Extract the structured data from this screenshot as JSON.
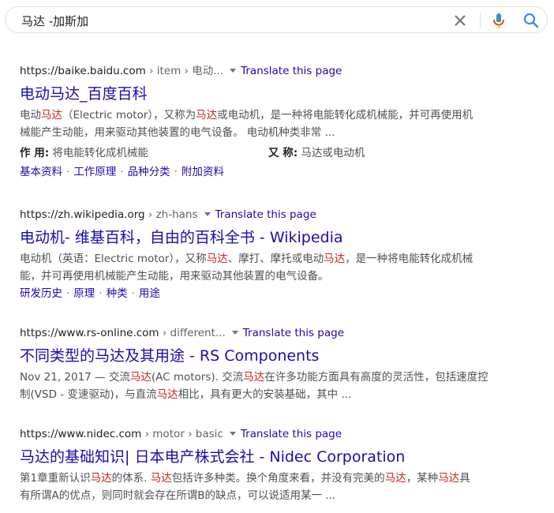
{
  "search": {
    "query": "马达 -加斯加"
  },
  "translate_label": "Translate this page",
  "results": [
    {
      "cite_domain": "https://baike.baidu.com",
      "cite_path": " › item › 电动...",
      "title": "电动马达_百度百科",
      "snippet": [
        "电动",
        {
          "hl": "马达"
        },
        "（Electric motor），又称为",
        {
          "hl": "马达"
        },
        "或电动机，是一种将电能转化成机械能，并可再使用机",
        {
          "br": true
        },
        "械能产生动能，用来驱动其他装置的电气设备。 电动机种类非常 ..."
      ],
      "meta": [
        {
          "label": "作 用:",
          "value": "将电能转化成机械能"
        },
        {
          "label": "又 称:",
          "value": "马达或电动机"
        }
      ],
      "sitelinks": [
        "基本资料",
        "工作原理",
        "品种分类",
        "附加资料"
      ]
    },
    {
      "cite_domain": "https://zh.wikipedia.org",
      "cite_path": " › zh-hans",
      "title": "电动机- 维基百科，自由的百科全书 - Wikipedia",
      "snippet": [
        "电动机（英语：Electric motor），又称",
        {
          "hl": "马达"
        },
        "、摩打、摩托或电动",
        {
          "hl": "马达"
        },
        "，是一种将电能转化成机械",
        {
          "br": true
        },
        "能，并可再使用机械能产生动能，用来驱动其他装置的电气设备。"
      ],
      "sitelinks": [
        "研发历史",
        "原理",
        "种类",
        "用途"
      ]
    },
    {
      "cite_domain": "https://www.rs-online.com",
      "cite_path": " › different...",
      "title": "不同类型的马达及其用途 - RS Components",
      "snippet": [
        "Nov 21, 2017 — 交流",
        {
          "hl": "马达"
        },
        "(AC motors). 交流",
        {
          "hl": "马达"
        },
        "在许多功能方面具有高度的灵活性，包括速度控",
        {
          "br": true
        },
        "制(VSD - 变速驱动)，与直流",
        {
          "hl": "马达"
        },
        "相比，具有更大的安装基础，其中 ..."
      ]
    },
    {
      "cite_domain": "https://www.nidec.com",
      "cite_path": " › motor › basic",
      "title": "马达的基础知识| 日本电产株式会社 - Nidec Corporation",
      "snippet": [
        "第1章重新认识",
        {
          "hl": "马达"
        },
        "的体系. ",
        {
          "hl": "马达"
        },
        "包括许多种类。换个角度来看，并没有完美的",
        {
          "hl": "马达"
        },
        "，某种",
        {
          "hl": "马达"
        },
        "具",
        {
          "br": true
        },
        "有所谓A的优点，则同时就会存在所谓B的缺点，可以说适用某一 ..."
      ]
    }
  ]
}
